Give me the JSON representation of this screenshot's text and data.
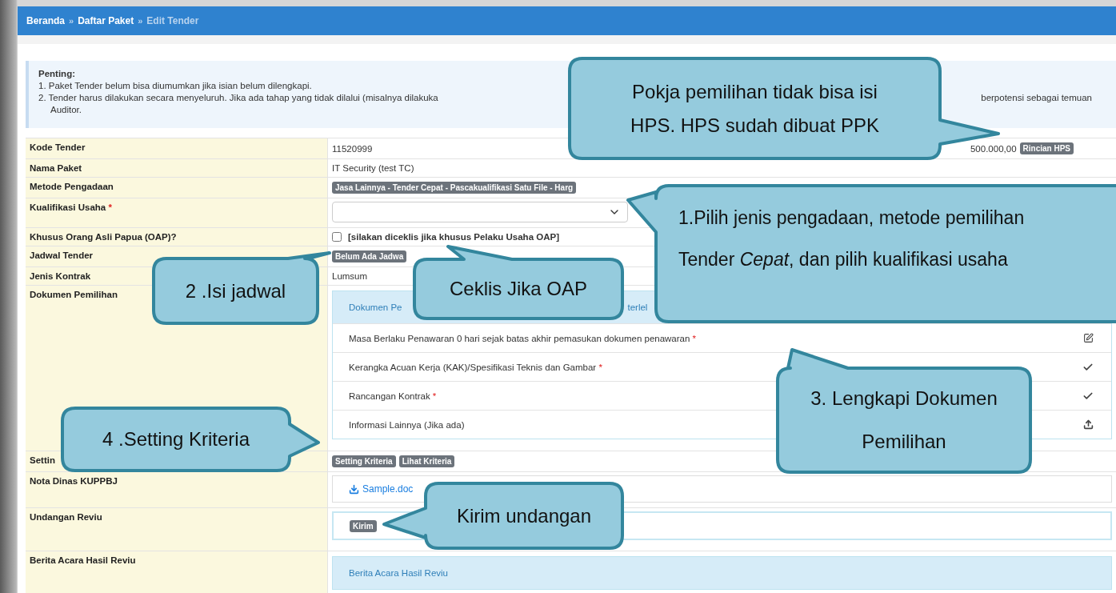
{
  "breadcrumb": {
    "separator": "»",
    "items": [
      {
        "label": "Beranda",
        "current": false
      },
      {
        "label": "Daftar Paket",
        "current": false
      },
      {
        "label": "Edit Tender",
        "current": true
      }
    ]
  },
  "notice": {
    "title": "Penting:",
    "items": [
      {
        "text": "1. Paket Tender belum bisa diumumkan jika isian belum dilengkapi."
      },
      {
        "text": "2. Tender harus dilakukan secara menyeluruh. Jika ada tahap yang tidak dilalui (misalnya dilakuka",
        "text_right": "berpotensi sebagai temuan",
        "continuation": "Auditor."
      }
    ]
  },
  "rows": [
    {
      "kind": "amount",
      "label": "Kode Tender",
      "value": "11520999",
      "amount": "500.000,00",
      "button": "Rincian HPS"
    },
    {
      "kind": "text",
      "label": "Nama Paket",
      "value": "IT Security (test TC)"
    },
    {
      "kind": "badges",
      "label": "Metode Pengadaan",
      "badges": [
        "Jasa Lainnya - Tender Cepat - Pascakualifikasi Satu File - Harg"
      ]
    },
    {
      "kind": "select",
      "label": "Kualifikasi Usaha",
      "required_mark": "*"
    },
    {
      "kind": "checkbox",
      "label": "Khusus Orang Asli Papua (OAP)?",
      "checked": false,
      "note": "[silakan diceklis jika khusus Pelaku Usaha OAP]"
    },
    {
      "kind": "badges",
      "label": "Jadwal Tender",
      "badges": [
        "Belum Ada Jadwa"
      ]
    },
    {
      "kind": "text",
      "label": "Jenis Kontrak",
      "value": "Lumsum"
    },
    {
      "kind": "documents",
      "label": "Dokumen Pemilihan",
      "header": [
        "Dokumen Pe",
        "terlel"
      ],
      "items": [
        {
          "text": "Masa Berlaku Penawaran 0 hari sejak batas akhir pemasukan dokumen penawaran",
          "required_mark": "*",
          "kind": "edit"
        },
        {
          "text": "Kerangka Acuan Kerja (KAK)/Spesifikasi Teknis dan Gambar",
          "required_mark": "*",
          "kind": "done"
        },
        {
          "text": "Rancangan Kontrak",
          "required_mark": "*",
          "kind": "done"
        },
        {
          "text": "Informasi Lainnya (Jika ada)",
          "kind": "upload"
        }
      ]
    },
    {
      "kind": "badges",
      "label": "Settin",
      "badges": [
        "Setting Kriteria",
        "Lihat Kriteria"
      ]
    },
    {
      "kind": "file",
      "label": "Nota Dinas KUPPBJ",
      "file": "Sample.doc"
    },
    {
      "kind": "action",
      "label": "Undangan Reviu",
      "button": "Kirim"
    },
    {
      "kind": "panel",
      "label": "Berita Acara Hasil Reviu",
      "header": "Berita Acara Hasil Reviu"
    }
  ],
  "callouts": [
    {
      "lines": [
        "Pokja pemilihan tidak bisa isi",
        "HPS. HPS sudah dibuat PPK"
      ]
    },
    {
      "lines": [
        "1.Pilih jenis pengadaan, metode pemilihan",
        "Tender *Cepat*, dan pilih kualifikasi usaha"
      ]
    },
    {
      "lines": [
        "2 .Isi jadwal"
      ]
    },
    {
      "lines": [
        "Ceklis Jika OAP"
      ]
    },
    {
      "lines": [
        "4 .Setting Kriteria"
      ]
    },
    {
      "lines": [
        "3. Lengkapi Dokumen",
        "Pemilihan"
      ]
    },
    {
      "lines": [
        "Kirim undangan"
      ]
    }
  ]
}
